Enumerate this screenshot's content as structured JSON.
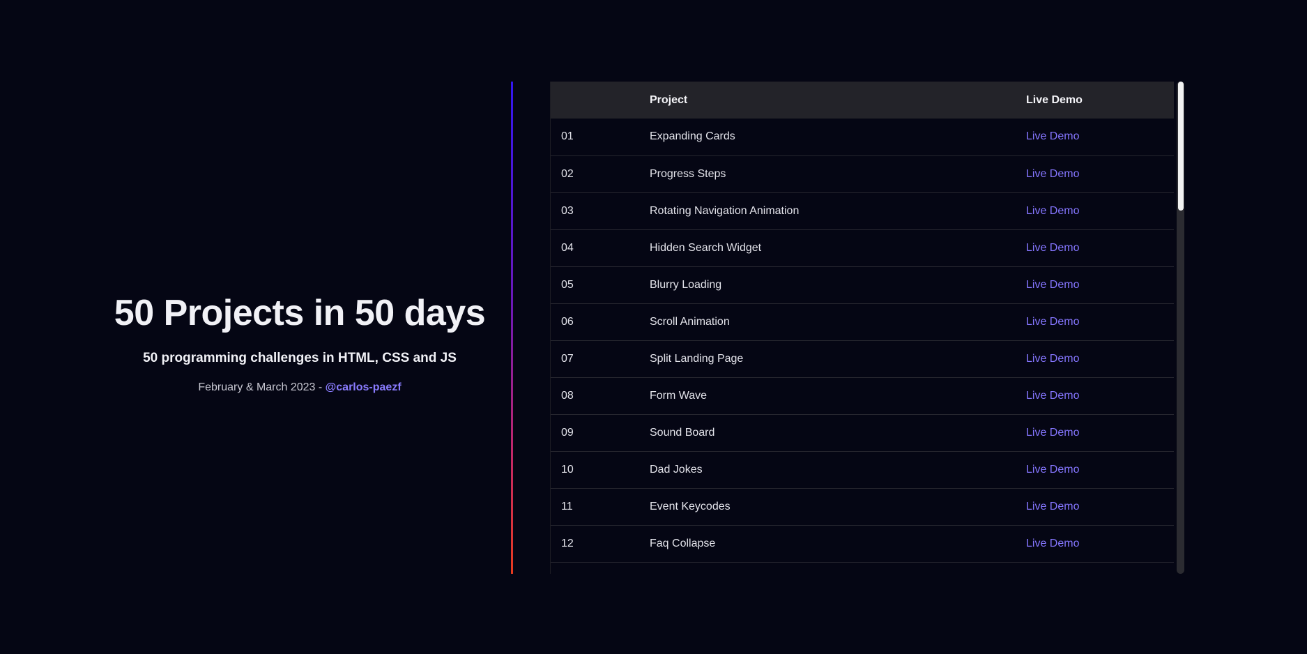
{
  "intro": {
    "title": "50 Projects in 50 days",
    "subtitle": "50 programming challenges in HTML, CSS and JS",
    "date": "February & March 2023 -",
    "author": "@carlos-paezf"
  },
  "table": {
    "headers": {
      "num": "",
      "project": "Project",
      "demo": "Live Demo"
    },
    "rows": [
      {
        "num": "01",
        "project": "Expanding Cards",
        "demo": "Live Demo"
      },
      {
        "num": "02",
        "project": "Progress Steps",
        "demo": "Live Demo"
      },
      {
        "num": "03",
        "project": "Rotating Navigation Animation",
        "demo": "Live Demo"
      },
      {
        "num": "04",
        "project": "Hidden Search Widget",
        "demo": "Live Demo"
      },
      {
        "num": "05",
        "project": "Blurry Loading",
        "demo": "Live Demo"
      },
      {
        "num": "06",
        "project": "Scroll Animation",
        "demo": "Live Demo"
      },
      {
        "num": "07",
        "project": "Split Landing Page",
        "demo": "Live Demo"
      },
      {
        "num": "08",
        "project": "Form Wave",
        "demo": "Live Demo"
      },
      {
        "num": "09",
        "project": "Sound Board",
        "demo": "Live Demo"
      },
      {
        "num": "10",
        "project": "Dad Jokes",
        "demo": "Live Demo"
      },
      {
        "num": "11",
        "project": "Event Keycodes",
        "demo": "Live Demo"
      },
      {
        "num": "12",
        "project": "Faq Collapse",
        "demo": "Live Demo"
      },
      {
        "num": "",
        "project": "",
        "demo": ""
      }
    ]
  },
  "colors": {
    "background": "#050614",
    "accent": "#8576ff",
    "header_bg": "#232329",
    "divider_top": "#3316f0",
    "divider_bottom": "#e83a1e"
  }
}
